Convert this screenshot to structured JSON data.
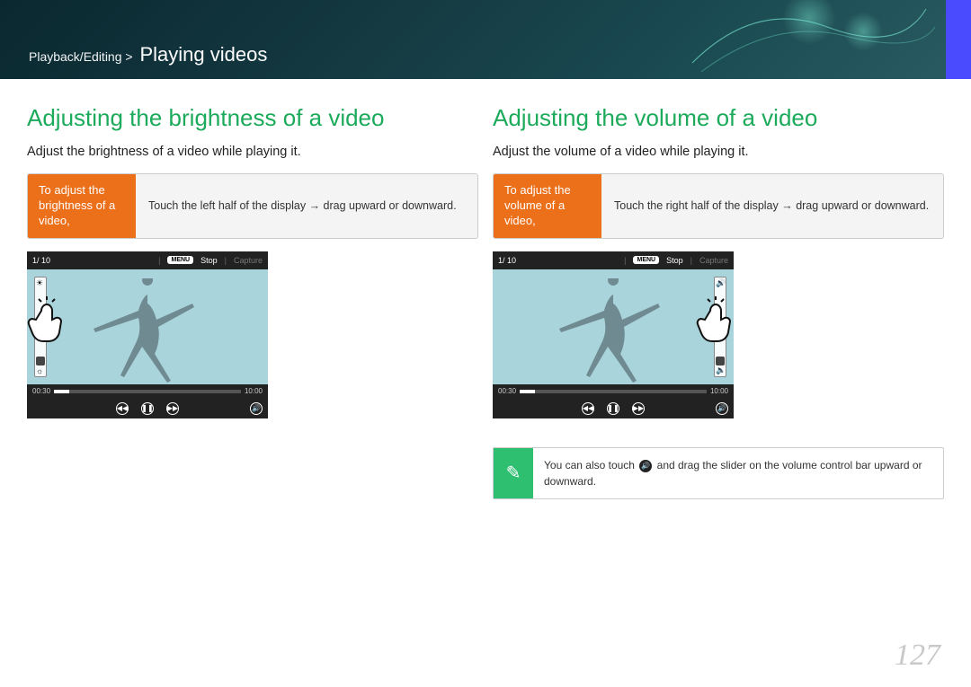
{
  "header": {
    "breadcrumb_section": "Playback/Editing >",
    "breadcrumb_title": "Playing videos"
  },
  "page_number": "127",
  "left": {
    "heading": "Adjusting the brightness of a video",
    "intro": "Adjust the brightness of a video while playing it.",
    "instruction_label": "To adjust the brightness of a video,",
    "instruction_body": "Touch the left half of the display → drag upward or downward.",
    "player": {
      "count": "1/ 10",
      "menu_badge": "MENU",
      "stop": "Stop",
      "capture": "Capture",
      "t_elapsed": "00:30",
      "t_total": "10:00"
    }
  },
  "right": {
    "heading": "Adjusting the volume of a video",
    "intro": "Adjust the volume of a video while playing it.",
    "instruction_label": "To adjust the volume of a video,",
    "instruction_body": "Touch the right half of the display → drag upward or downward.",
    "player": {
      "count": "1/ 10",
      "menu_badge": "MENU",
      "stop": "Stop",
      "capture": "Capture",
      "t_elapsed": "00:30",
      "t_total": "10:00"
    },
    "note_pre": "You can also touch ",
    "note_post": " and drag the slider on the volume control bar upward or downward."
  }
}
